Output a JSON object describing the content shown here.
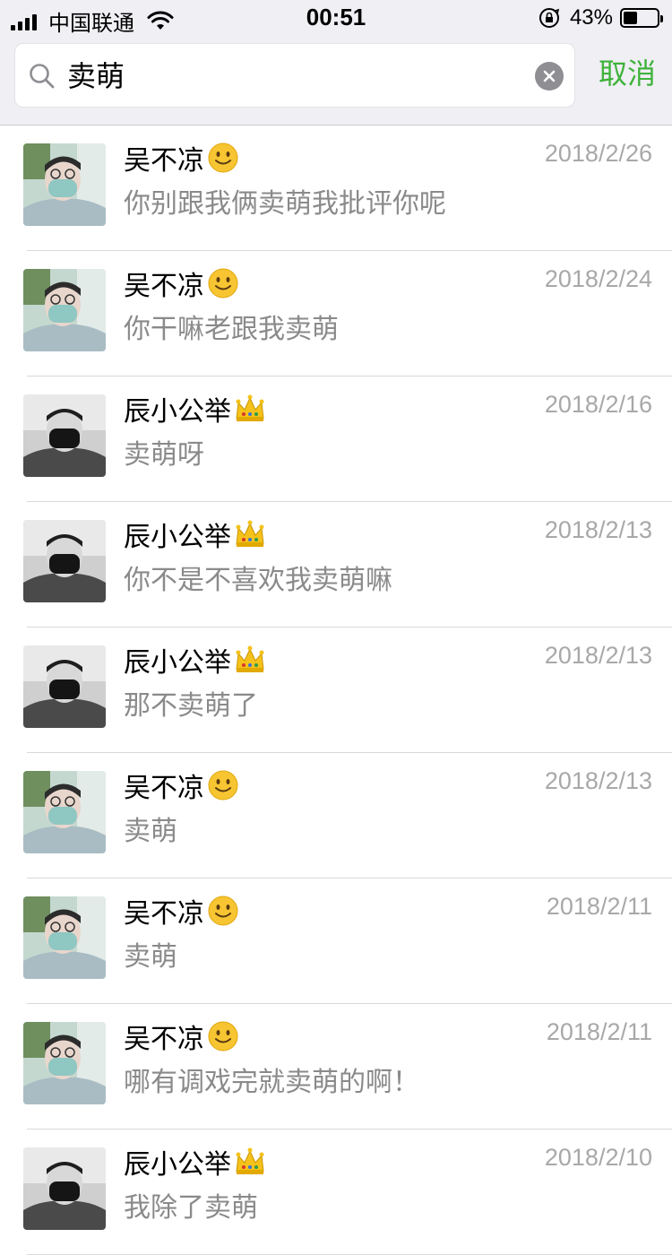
{
  "status_bar": {
    "carrier": "中国联通",
    "time": "00:51",
    "battery_percent": "43%",
    "battery_level": 0.43
  },
  "search": {
    "query": "卖萌",
    "cancel_label": "取消"
  },
  "messages": [
    {
      "sender": "吴不凉",
      "badge": "smile-emoji-icon",
      "date": "2018/2/26",
      "text": "你别跟我俩卖萌我批评你呢"
    },
    {
      "sender": "吴不凉",
      "badge": "smile-emoji-icon",
      "date": "2018/2/24",
      "text": "你干嘛老跟我卖萌"
    },
    {
      "sender": "辰小公举",
      "badge": "crown-emoji-icon",
      "date": "2018/2/16",
      "text": "卖萌呀"
    },
    {
      "sender": "辰小公举",
      "badge": "crown-emoji-icon",
      "date": "2018/2/13",
      "text": "你不是不喜欢我卖萌嘛"
    },
    {
      "sender": "辰小公举",
      "badge": "crown-emoji-icon",
      "date": "2018/2/13",
      "text": "那不卖萌了"
    },
    {
      "sender": "吴不凉",
      "badge": "smile-emoji-icon",
      "date": "2018/2/13",
      "text": "卖萌"
    },
    {
      "sender": "吴不凉",
      "badge": "smile-emoji-icon",
      "date": "2018/2/11",
      "text": "卖萌"
    },
    {
      "sender": "吴不凉",
      "badge": "smile-emoji-icon",
      "date": "2018/2/11",
      "text": "哪有调戏完就卖萌的啊！"
    },
    {
      "sender": "辰小公举",
      "badge": "crown-emoji-icon",
      "date": "2018/2/10",
      "text": "我除了卖萌"
    }
  ],
  "colors": {
    "accent_green": "#3fb23a",
    "header_bg": "#efeff4",
    "date_gray": "#a8a8a8",
    "message_gray": "#8a8a8a"
  }
}
